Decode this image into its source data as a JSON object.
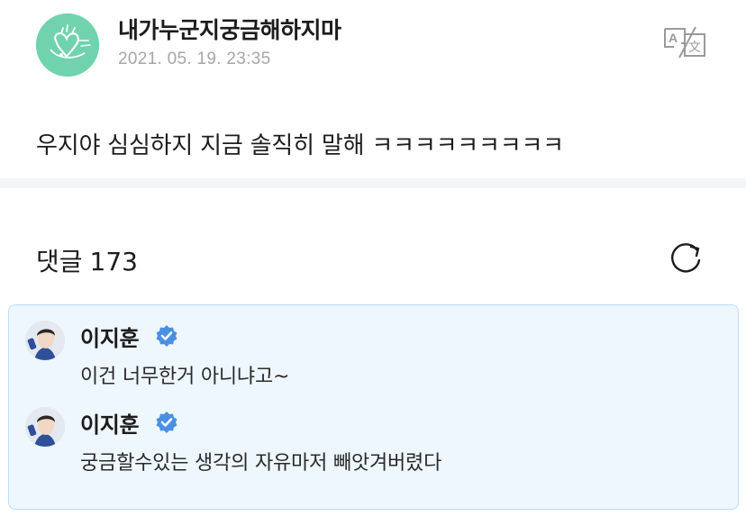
{
  "post": {
    "author": "내가누군지궁금해하지마",
    "timestamp": "2021. 05. 19. 23:35",
    "body": "우지야 심심하지 지금 솔직히 말해 ㅋㅋㅋㅋㅋㅋㅋㅋㅋ",
    "translate_icon": "translate-icon"
  },
  "comments_section": {
    "label": "댓글",
    "count": "173",
    "refresh_icon": "refresh-icon"
  },
  "comments": [
    {
      "author": "이지훈",
      "verified": true,
      "text": "이건 너무한거 아니냐고~"
    },
    {
      "author": "이지훈",
      "verified": true,
      "text": "궁금할수있는 생각의 자유마저 빼앗겨버렸다"
    }
  ],
  "colors": {
    "avatar_bg": "#71d3ad",
    "verified_blue": "#4a90e2",
    "comments_bg": "#eef7fd",
    "comments_border": "#b9def1",
    "divider": "#f4f5f7"
  }
}
